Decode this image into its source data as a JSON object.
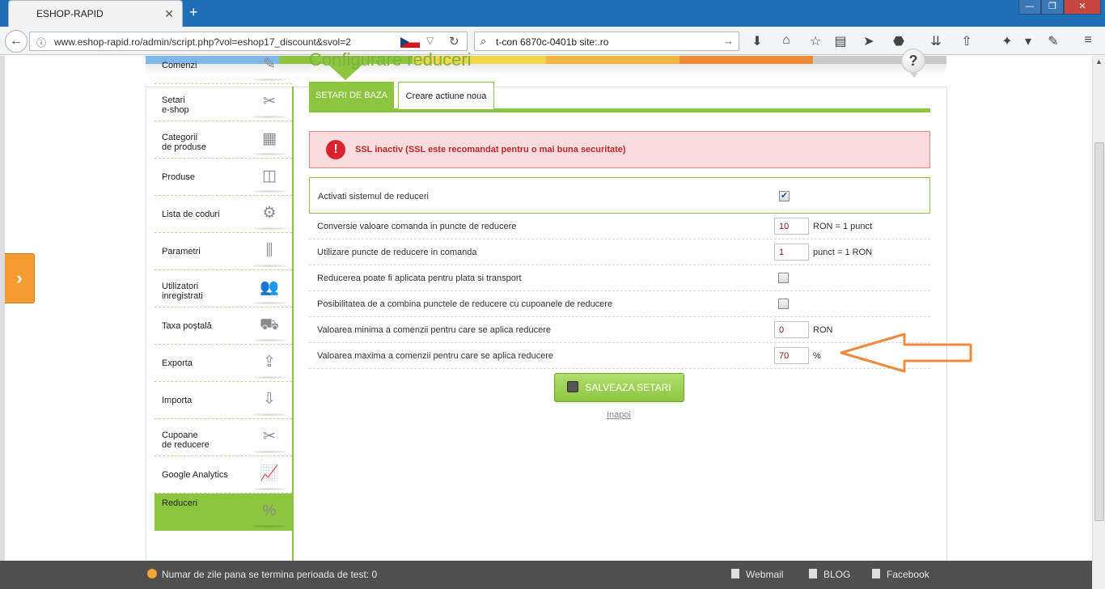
{
  "browser": {
    "tab_title": "ESHOP-RAPID",
    "tab_close": "✕",
    "new_tab": "+",
    "url": "www.eshop-rapid.ro/admin/script.php?vol=eshop17_discount&svol=2",
    "search_value": "t-con 6870c-0401b site:.ro",
    "win_min": "—",
    "win_max": "❐",
    "win_close": "✕"
  },
  "sidebar": {
    "items": [
      {
        "label1": "Comenzi",
        "label2": "",
        "icon": "✎"
      },
      {
        "label1": "Setari",
        "label2": "e-shop",
        "icon": "✂"
      },
      {
        "label1": "Categorii",
        "label2": "de produse",
        "icon": "▦"
      },
      {
        "label1": "Produse",
        "label2": "",
        "icon": "◫"
      },
      {
        "label1": "Lista de coduri",
        "label2": "",
        "icon": "⚙"
      },
      {
        "label1": "Parametri",
        "label2": "",
        "icon": "⫼"
      },
      {
        "label1": "Utilizatori",
        "label2": "inregistrati",
        "icon": "👥"
      },
      {
        "label1": "Taxa poştală",
        "label2": "",
        "icon": "⛟"
      },
      {
        "label1": "Exporta",
        "label2": "",
        "icon": "⇪"
      },
      {
        "label1": "Importa",
        "label2": "",
        "icon": "⇩"
      },
      {
        "label1": "Cupoane",
        "label2": "de reducere",
        "icon": "✂"
      },
      {
        "label1": "Google Analytics",
        "label2": "",
        "icon": "📈"
      },
      {
        "label1": "Reduceri",
        "label2": "",
        "icon": "%"
      }
    ]
  },
  "main": {
    "title": "Configurare reduceri",
    "help": "?",
    "tabs": [
      {
        "label": "SETARI DE BAZA"
      },
      {
        "label": "Creare actiune noua"
      }
    ],
    "alert": "SSL inactiv (SSL este recomandat pentru o mai buna securitate)",
    "alert_icon": "!",
    "settings": [
      {
        "label": "Activati sistemul de reduceri",
        "type": "checkbox",
        "checked": true,
        "mark": "✔"
      },
      {
        "label": "Conversie valoare comanda in puncte de reducere",
        "type": "input",
        "value": "10",
        "unit": "RON = 1 punct"
      },
      {
        "label": "Utilizare puncte de reducere in comanda",
        "type": "input",
        "value": "1",
        "unit": "punct = 1 RON"
      },
      {
        "label": "Reducerea poate fi aplicata pentru plata si transport",
        "type": "checkbox",
        "checked": false,
        "mark": ""
      },
      {
        "label": "Posibilitatea de a combina punctele de reducere cu cupoanele de reducere",
        "type": "checkbox",
        "checked": false,
        "mark": ""
      },
      {
        "label": "Valoarea minima a comenzii pentru care se aplica reducere",
        "type": "input",
        "value": "0",
        "unit": "RON"
      },
      {
        "label": "Valoarea maxima a comenzii pentru care se aplica reducere",
        "type": "input",
        "value": "70",
        "unit": "%"
      }
    ],
    "save_label": "SALVEAZA SETARI",
    "back_label": "Inapoi"
  },
  "bottom": {
    "trial": "Numar de zile pana se termina perioada de test: 0",
    "webmail": "Webmail",
    "blog": "BLOG",
    "facebook": "Facebook"
  },
  "colors": {
    "accent": "#8cc63f",
    "strip": [
      "#7fb8e8",
      "#8cc63f",
      "#f5d54a",
      "#f4b63f",
      "#ee8a34",
      "#c9c9c9"
    ],
    "annotation_arrow": "#f28a3c"
  }
}
